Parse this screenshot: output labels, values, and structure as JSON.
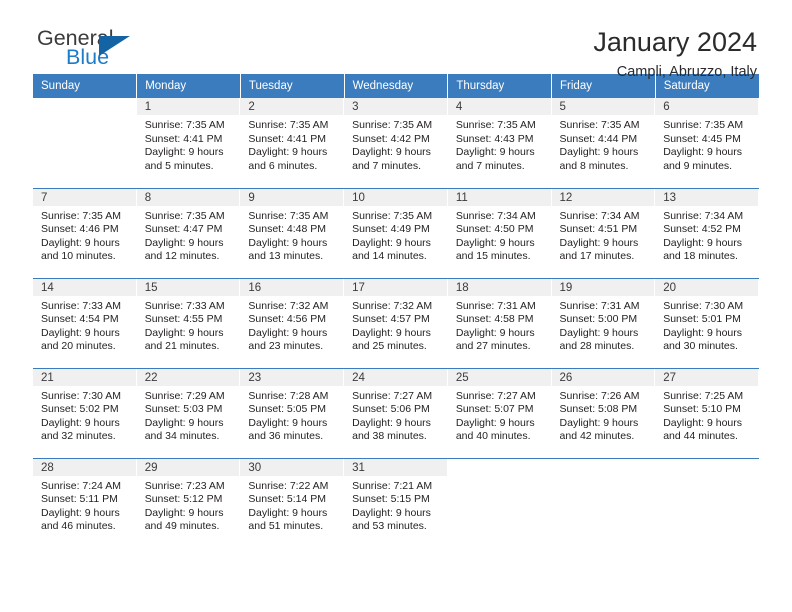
{
  "brand": {
    "word_one": "General",
    "word_two": "Blue",
    "triangle_color": "#1464a5",
    "blue_color": "#1e7bc8"
  },
  "header": {
    "title": "January 2024",
    "subtitle": "Campli, Abruzzo, Italy"
  },
  "theme": {
    "header_bg": "#3a7cbe",
    "header_text": "#ffffff",
    "daynum_band_bg": "#f0f0f0",
    "row_separator": "#3a7cbe",
    "body_text": "#231f20"
  },
  "weekday_headers": [
    "Sunday",
    "Monday",
    "Tuesday",
    "Wednesday",
    "Thursday",
    "Friday",
    "Saturday"
  ],
  "labels": {
    "sunrise_prefix": "Sunrise:",
    "sunset_prefix": "Sunset:",
    "daylight_prefix": "Daylight:"
  },
  "weeks": [
    [
      {
        "day": "",
        "lines": []
      },
      {
        "day": "1",
        "lines": [
          "Sunrise: 7:35 AM",
          "Sunset: 4:41 PM",
          "Daylight: 9 hours",
          "and 5 minutes."
        ]
      },
      {
        "day": "2",
        "lines": [
          "Sunrise: 7:35 AM",
          "Sunset: 4:41 PM",
          "Daylight: 9 hours",
          "and 6 minutes."
        ]
      },
      {
        "day": "3",
        "lines": [
          "Sunrise: 7:35 AM",
          "Sunset: 4:42 PM",
          "Daylight: 9 hours",
          "and 7 minutes."
        ]
      },
      {
        "day": "4",
        "lines": [
          "Sunrise: 7:35 AM",
          "Sunset: 4:43 PM",
          "Daylight: 9 hours",
          "and 7 minutes."
        ]
      },
      {
        "day": "5",
        "lines": [
          "Sunrise: 7:35 AM",
          "Sunset: 4:44 PM",
          "Daylight: 9 hours",
          "and 8 minutes."
        ]
      },
      {
        "day": "6",
        "lines": [
          "Sunrise: 7:35 AM",
          "Sunset: 4:45 PM",
          "Daylight: 9 hours",
          "and 9 minutes."
        ]
      }
    ],
    [
      {
        "day": "7",
        "lines": [
          "Sunrise: 7:35 AM",
          "Sunset: 4:46 PM",
          "Daylight: 9 hours",
          "and 10 minutes."
        ]
      },
      {
        "day": "8",
        "lines": [
          "Sunrise: 7:35 AM",
          "Sunset: 4:47 PM",
          "Daylight: 9 hours",
          "and 12 minutes."
        ]
      },
      {
        "day": "9",
        "lines": [
          "Sunrise: 7:35 AM",
          "Sunset: 4:48 PM",
          "Daylight: 9 hours",
          "and 13 minutes."
        ]
      },
      {
        "day": "10",
        "lines": [
          "Sunrise: 7:35 AM",
          "Sunset: 4:49 PM",
          "Daylight: 9 hours",
          "and 14 minutes."
        ]
      },
      {
        "day": "11",
        "lines": [
          "Sunrise: 7:34 AM",
          "Sunset: 4:50 PM",
          "Daylight: 9 hours",
          "and 15 minutes."
        ]
      },
      {
        "day": "12",
        "lines": [
          "Sunrise: 7:34 AM",
          "Sunset: 4:51 PM",
          "Daylight: 9 hours",
          "and 17 minutes."
        ]
      },
      {
        "day": "13",
        "lines": [
          "Sunrise: 7:34 AM",
          "Sunset: 4:52 PM",
          "Daylight: 9 hours",
          "and 18 minutes."
        ]
      }
    ],
    [
      {
        "day": "14",
        "lines": [
          "Sunrise: 7:33 AM",
          "Sunset: 4:54 PM",
          "Daylight: 9 hours",
          "and 20 minutes."
        ]
      },
      {
        "day": "15",
        "lines": [
          "Sunrise: 7:33 AM",
          "Sunset: 4:55 PM",
          "Daylight: 9 hours",
          "and 21 minutes."
        ]
      },
      {
        "day": "16",
        "lines": [
          "Sunrise: 7:32 AM",
          "Sunset: 4:56 PM",
          "Daylight: 9 hours",
          "and 23 minutes."
        ]
      },
      {
        "day": "17",
        "lines": [
          "Sunrise: 7:32 AM",
          "Sunset: 4:57 PM",
          "Daylight: 9 hours",
          "and 25 minutes."
        ]
      },
      {
        "day": "18",
        "lines": [
          "Sunrise: 7:31 AM",
          "Sunset: 4:58 PM",
          "Daylight: 9 hours",
          "and 27 minutes."
        ]
      },
      {
        "day": "19",
        "lines": [
          "Sunrise: 7:31 AM",
          "Sunset: 5:00 PM",
          "Daylight: 9 hours",
          "and 28 minutes."
        ]
      },
      {
        "day": "20",
        "lines": [
          "Sunrise: 7:30 AM",
          "Sunset: 5:01 PM",
          "Daylight: 9 hours",
          "and 30 minutes."
        ]
      }
    ],
    [
      {
        "day": "21",
        "lines": [
          "Sunrise: 7:30 AM",
          "Sunset: 5:02 PM",
          "Daylight: 9 hours",
          "and 32 minutes."
        ]
      },
      {
        "day": "22",
        "lines": [
          "Sunrise: 7:29 AM",
          "Sunset: 5:03 PM",
          "Daylight: 9 hours",
          "and 34 minutes."
        ]
      },
      {
        "day": "23",
        "lines": [
          "Sunrise: 7:28 AM",
          "Sunset: 5:05 PM",
          "Daylight: 9 hours",
          "and 36 minutes."
        ]
      },
      {
        "day": "24",
        "lines": [
          "Sunrise: 7:27 AM",
          "Sunset: 5:06 PM",
          "Daylight: 9 hours",
          "and 38 minutes."
        ]
      },
      {
        "day": "25",
        "lines": [
          "Sunrise: 7:27 AM",
          "Sunset: 5:07 PM",
          "Daylight: 9 hours",
          "and 40 minutes."
        ]
      },
      {
        "day": "26",
        "lines": [
          "Sunrise: 7:26 AM",
          "Sunset: 5:08 PM",
          "Daylight: 9 hours",
          "and 42 minutes."
        ]
      },
      {
        "day": "27",
        "lines": [
          "Sunrise: 7:25 AM",
          "Sunset: 5:10 PM",
          "Daylight: 9 hours",
          "and 44 minutes."
        ]
      }
    ],
    [
      {
        "day": "28",
        "lines": [
          "Sunrise: 7:24 AM",
          "Sunset: 5:11 PM",
          "Daylight: 9 hours",
          "and 46 minutes."
        ]
      },
      {
        "day": "29",
        "lines": [
          "Sunrise: 7:23 AM",
          "Sunset: 5:12 PM",
          "Daylight: 9 hours",
          "and 49 minutes."
        ]
      },
      {
        "day": "30",
        "lines": [
          "Sunrise: 7:22 AM",
          "Sunset: 5:14 PM",
          "Daylight: 9 hours",
          "and 51 minutes."
        ]
      },
      {
        "day": "31",
        "lines": [
          "Sunrise: 7:21 AM",
          "Sunset: 5:15 PM",
          "Daylight: 9 hours",
          "and 53 minutes."
        ]
      },
      {
        "day": "",
        "lines": []
      },
      {
        "day": "",
        "lines": []
      },
      {
        "day": "",
        "lines": []
      }
    ]
  ]
}
